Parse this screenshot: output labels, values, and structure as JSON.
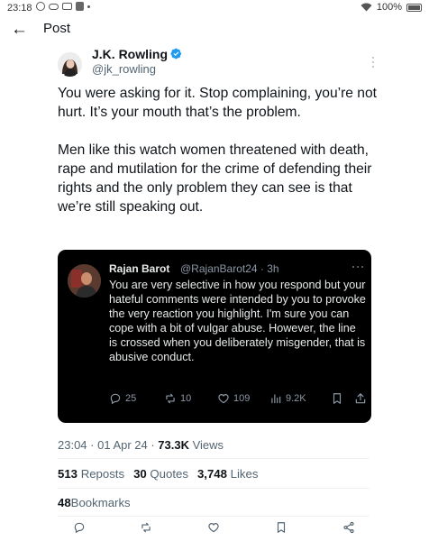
{
  "status_bar": {
    "time": "23:18",
    "battery": "100%"
  },
  "header": {
    "title": "Post"
  },
  "author": {
    "name": "J.K. Rowling",
    "handle": "@jk_rowling"
  },
  "tweet": {
    "paragraphs": [
      "You were asking for it. Stop complaining, you’re not hurt. It’s your mouth that’s the problem.",
      "Men like this watch women threatened with death, rape and mutilation for the crime of defending their rights and the only problem they can see is that we’re still speaking out."
    ]
  },
  "quote": {
    "name": "Rajan Barot",
    "handle": "@RajanBarot24",
    "time": "· 3h",
    "text": "You are very selective in how you respond but your hateful comments were intended by you to provoke the very reaction you highlight. I'm sure you can cope with a bit of vulgar abuse. However, the line is crossed when you deliberately misgender, that is abusive conduct.",
    "replies": "25",
    "reposts": "10",
    "likes": "109",
    "views": "9.2K"
  },
  "meta": {
    "time": "23:04 · 01 Apr 24 · ",
    "views_count": "73.3K",
    "views_label": " Views"
  },
  "stats": {
    "reposts_count": "513",
    "reposts_label": "Reposts",
    "quotes_count": "30",
    "quotes_label": "Quotes",
    "likes_count": "3,748",
    "likes_label": "Likes",
    "bookmarks_count": "48",
    "bookmarks_label": "Bookmarks"
  },
  "colors": {
    "verified": "#1d9bf0",
    "quote_bg": "#000000",
    "secondary_text": "#536471"
  },
  "icons": [
    "back-arrow-icon",
    "verified-badge-icon",
    "more-icon",
    "reply-icon",
    "repost-icon",
    "like-icon",
    "views-icon",
    "bookmark-icon",
    "share-icon"
  ]
}
